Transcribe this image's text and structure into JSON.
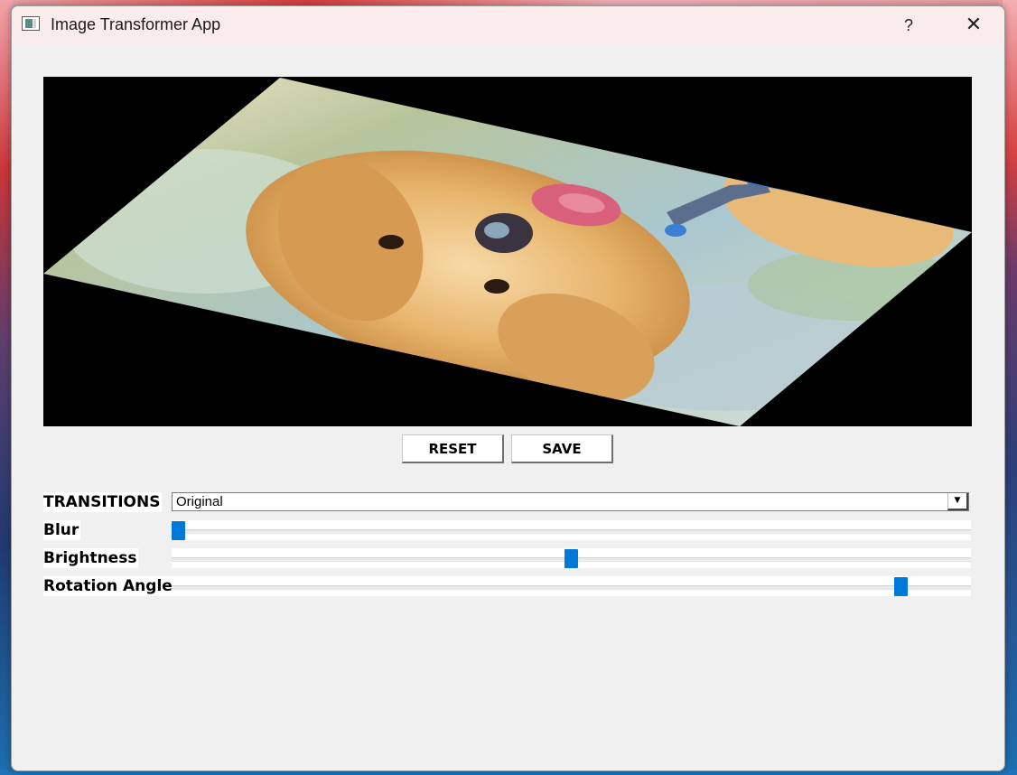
{
  "window": {
    "title": "Image Transformer App",
    "help_symbol": "?",
    "close_symbol": "✕"
  },
  "image_panel": {
    "description_icon": "rotated-puppy-image",
    "rotation_deg": -160
  },
  "buttons": {
    "reset_label": "RESET",
    "save_label": "SAVE"
  },
  "controls": {
    "transitions_label": "TRANSITIONS",
    "transitions_value": "Original",
    "blur_label": "Blur",
    "blur_value": 0.0,
    "brightness_label": "Brightness",
    "brightness_value": 0.5,
    "rotation_label": "Rotation Angle",
    "rotation_value": 0.92
  },
  "colors": {
    "slider_handle": "#0078d7",
    "window_bg": "#f0f0f0",
    "titlebar_bg": "#fbecec"
  }
}
